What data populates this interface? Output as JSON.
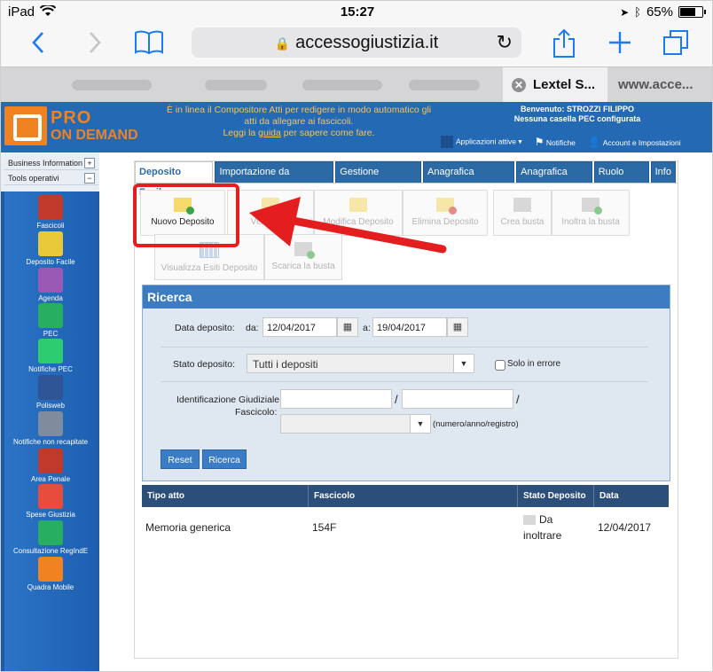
{
  "status_bar": {
    "device": "iPad",
    "time": "15:27",
    "battery": "65%"
  },
  "browser": {
    "url": "accessogiustizia.it",
    "tabs": [
      {
        "label": "Lextel S...",
        "active": true
      },
      {
        "label": "www.acce...",
        "active": false
      }
    ]
  },
  "app_header": {
    "logo_pro": "PRO",
    "logo_ondemand": "ON DEMAND",
    "message_line1": "È in linea il Compositore Atti per redigere in modo automatico gli",
    "message_line2": "atti da allegare ai fascicoli.",
    "message_line3_pre": "Leggi la ",
    "message_line3_link": "guida",
    "message_line3_post": " per sapere come fare.",
    "welcome": "Benvenuto: STROZZI FILIPPO",
    "pec_status": "Nessuna casella PEC configurata",
    "links": {
      "apps": "Applicazioni attive",
      "notifiche": "Notifiche",
      "account": "Account e Impostazioni"
    }
  },
  "sidebar": {
    "sections": [
      {
        "label": "Business Information",
        "toggle": "+"
      },
      {
        "label": "Tools operativi",
        "toggle": "−"
      }
    ],
    "tools": [
      {
        "label": "Fascicoli",
        "color": "#c0392b"
      },
      {
        "label": "Deposito Facile",
        "color": "#e8c93a"
      },
      {
        "label": "Agenda",
        "color": "#9b59b6"
      },
      {
        "label": "PEC",
        "color": "#27ae60"
      },
      {
        "label": "Notifiche PEC",
        "color": "#2ecc71"
      },
      {
        "label": "Polisweb",
        "color": "#2f5597"
      },
      {
        "label": "Notifiche non recapitate",
        "color": "#7f8c9d"
      },
      {
        "label": "Area Penale",
        "color": "#c0392b"
      },
      {
        "label": "Spese Giustizia",
        "color": "#e74c3c"
      },
      {
        "label": "Consultazione RegIndE",
        "color": "#27ae60"
      },
      {
        "label": "Quadra Mobile",
        "color": "#f08220"
      }
    ]
  },
  "nav_tabs": [
    {
      "label": "Deposito Facile",
      "active": true
    },
    {
      "label": "Importazione da PolisWeb",
      "active": false
    },
    {
      "label": "Gestione Fascicoli",
      "active": false
    },
    {
      "label": "Anagrafica Avvocati",
      "active": false
    },
    {
      "label": "Anagrafica Parti",
      "active": false
    },
    {
      "label": "Ruolo PCT",
      "active": false
    },
    {
      "label": "Info",
      "active": false
    }
  ],
  "toolbar": {
    "nuovo": "Nuovo Deposito",
    "visualizza": "Visualizza",
    "modifica": "Modifica Deposito",
    "elimina": "Elimina Deposito",
    "crea_busta": "Crea busta",
    "inoltra_busta": "Inoltra la busta",
    "visualizza_esiti": "Visualizza Esiti Deposito",
    "scarica_busta": "Scarica la busta"
  },
  "ricerca": {
    "title": "Ricerca",
    "data_label": "Data deposito:",
    "da_label": "da:",
    "da_value": "12/04/2017",
    "a_label": "a:",
    "a_value": "19/04/2017",
    "stato_label": "Stato deposito:",
    "stato_value": "Tutti i depositi",
    "solo_errore": "Solo in errore",
    "ident_label_1": "Identificazione Giudiziale",
    "ident_label_2": "Fascicolo:",
    "slash": "/",
    "format_hint": "(numero/anno/registro)",
    "reset": "Reset",
    "ricerca_btn": "Ricerca"
  },
  "results": {
    "headers": [
      "Tipo atto",
      "Fascicolo",
      "Stato Deposito",
      "Data"
    ],
    "rows": [
      {
        "tipo": "Memoria generica",
        "fascicolo": "154F",
        "stato_1": "Da",
        "stato_2": "inoltrare",
        "data": "12/04/2017"
      }
    ]
  },
  "colors": {
    "brand_blue": "#2469b4",
    "brand_orange": "#f08220",
    "highlight_red": "#e41e1e"
  }
}
